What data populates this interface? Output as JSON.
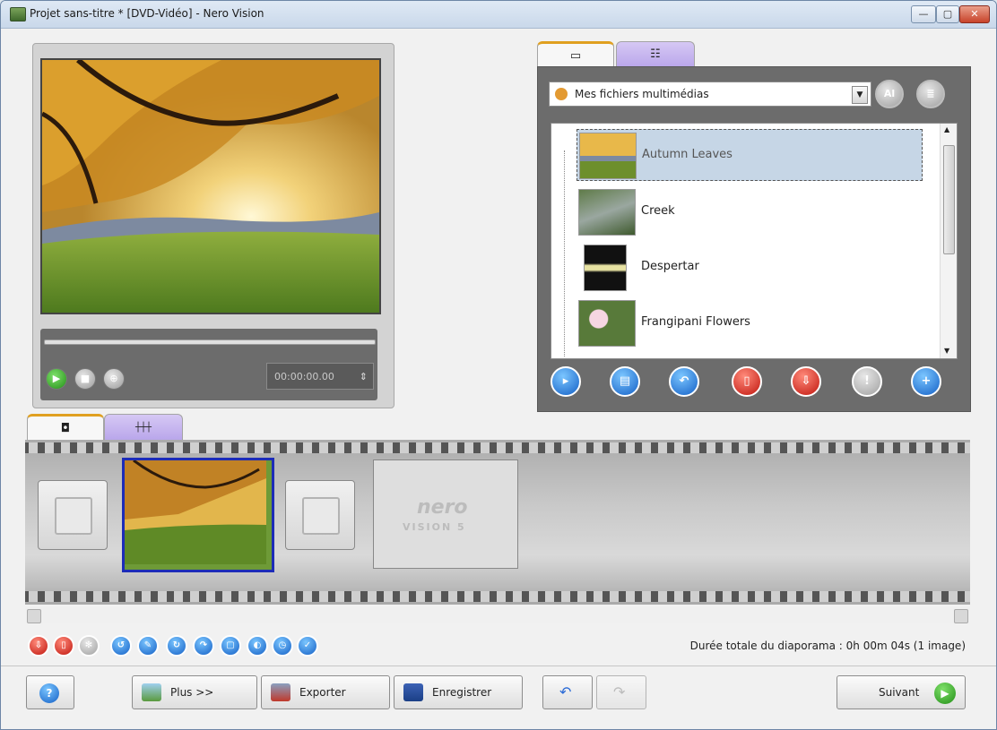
{
  "window": {
    "title": "Projet sans-titre * [DVD-Vidéo] - Nero Vision",
    "min": "—",
    "max": "▢",
    "close": "✕"
  },
  "preview": {
    "timecode": "00:00:00.00"
  },
  "library": {
    "tab1_icon": "filmstrip-icon",
    "tab2_icon": "detail-view-icon",
    "dropdown_value": "Mes fichiers multimédias",
    "items": [
      {
        "label": "Autumn Leaves",
        "selected": true
      },
      {
        "label": "Creek",
        "selected": false
      },
      {
        "label": "Despertar",
        "selected": false
      },
      {
        "label": "Frangipani Flowers",
        "selected": false
      }
    ]
  },
  "nero_logo": {
    "brand": "nero",
    "product": "VISION 5"
  },
  "status_text": "Durée totale du diaporama : 0h 00m 04s (1 image)",
  "bottom": {
    "plus": "Plus >>",
    "exporter": "Exporter",
    "enregistrer": "Enregistrer",
    "suivant": "Suivant"
  },
  "colors": {
    "accent_blue": "#1d2cb8",
    "red": "#c0160e",
    "green": "#3aa02c"
  }
}
